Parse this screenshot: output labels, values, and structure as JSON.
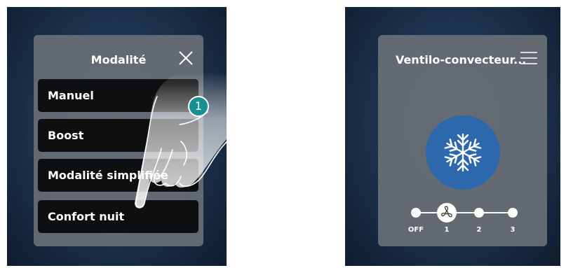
{
  "mode_menu": {
    "title": "Modalité",
    "items": [
      {
        "label": "Manuel"
      },
      {
        "label": "Boost"
      },
      {
        "label": "Modalité simplifiée"
      },
      {
        "label": "Confort nuit"
      }
    ]
  },
  "step_badge": "1",
  "fan_coil": {
    "title": "Ventilo-convecteur...",
    "mode_icon": "snowflake-icon",
    "speed_labels": [
      "OFF",
      "1",
      "2",
      "3"
    ],
    "selected_speed": "1"
  },
  "colors": {
    "background": "#1d3550",
    "panel": "#696f75",
    "item": "#0e0f10",
    "fan_button": "#2d68ad",
    "step_badge": "#188f97"
  }
}
